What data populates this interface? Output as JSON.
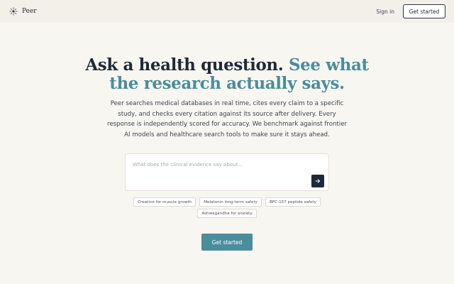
{
  "header": {
    "brand": "Peer",
    "logo_icon": "sun-burst-icon",
    "sign_in": "Sign in",
    "get_started": "Get started"
  },
  "hero": {
    "title_line1": "Ask a health question.",
    "title_accent_part1": "See what",
    "title_accent_part2": "the research actually says.",
    "description": "Peer searches medical databases in real time, cites every claim to a specific study, and checks every citation against its source after delivery. Every response is independently scored for accuracy. We benchmark against frontier AI models and healthcare search tools to make sure it stays ahead."
  },
  "search": {
    "placeholder": "What does the clinical evidence say about...",
    "value": "",
    "submit_icon": "arrow-right-icon"
  },
  "suggestions": [
    "Creatine for muscle growth",
    "Melatonin long-term safety",
    "BPC-157 peptide safety",
    "Ashwagandha for anxiety"
  ],
  "cta": {
    "label": "Get started"
  },
  "colors": {
    "accent": "#4a8d9c",
    "dark": "#1f2a37",
    "background": "#f8f6f1",
    "header_background": "#f3f0ea"
  }
}
